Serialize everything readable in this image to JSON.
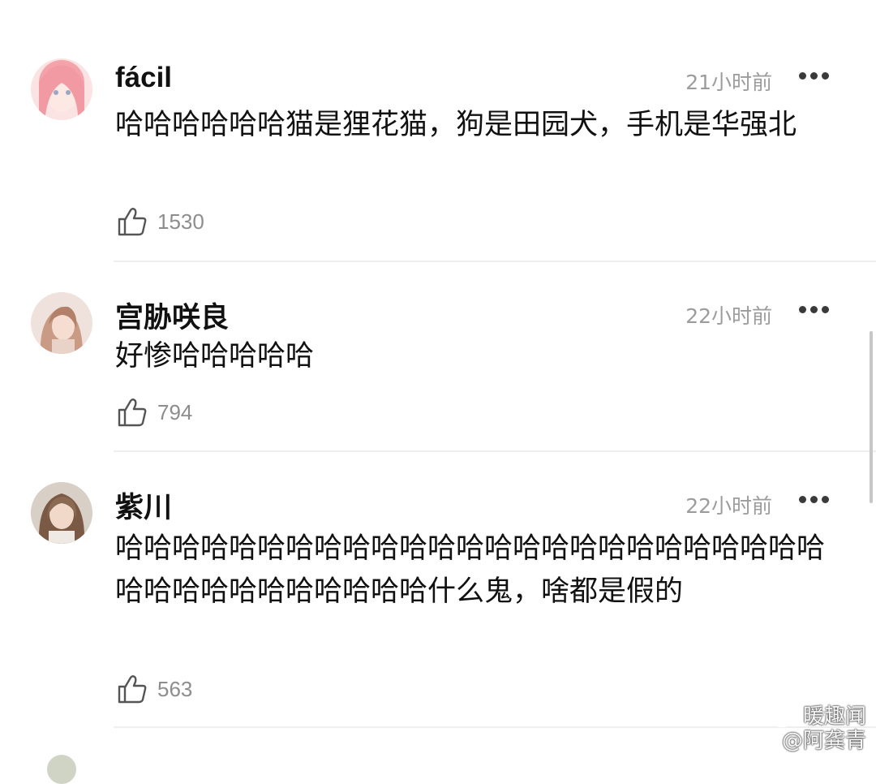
{
  "comments": [
    {
      "username": "fácil",
      "time": "21小时前",
      "text": "哈哈哈哈哈哈猫是狸花猫，狗是田园犬，手机是华强北",
      "likes": "1530"
    },
    {
      "username": "宫胁咲良",
      "time": "22小时前",
      "text": "好惨哈哈哈哈哈",
      "likes": "794"
    },
    {
      "username": "紫川",
      "time": "22小时前",
      "text": "哈哈哈哈哈哈哈哈哈哈哈哈哈哈哈哈哈哈哈哈哈哈哈哈哈哈哈哈哈哈哈哈哈哈哈哈什么鬼，啥都是假的",
      "likes": "563"
    }
  ],
  "icons": {
    "more": "more-dots-icon",
    "like": "thumbs-up-icon",
    "watermark": "weibo-logo-icon"
  },
  "watermark": {
    "line1": "暖趣闻",
    "line2": "@阿龚青"
  },
  "colors": {
    "time": "#9c9c9c",
    "likes": "#8d8d8d",
    "divider": "#eeeeee"
  }
}
